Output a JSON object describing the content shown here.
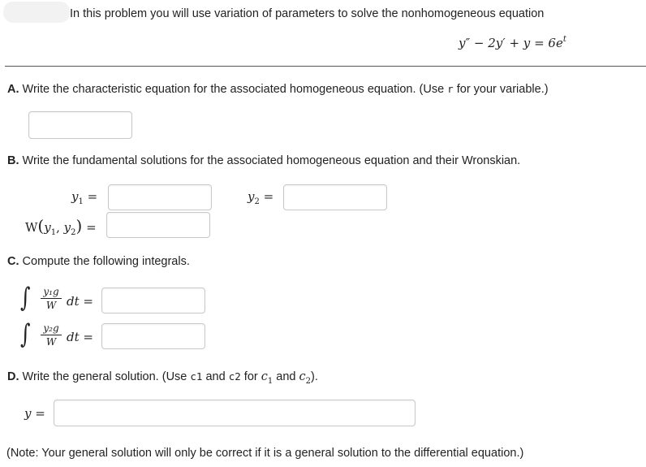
{
  "intro": "In this problem you will use variation of parameters to solve the nonhomogeneous equation",
  "equation": {
    "y_double_prime": "y″",
    "minus": "−",
    "two_y_prime": "2y′",
    "plus": "+",
    "y": "y",
    "equals": "=",
    "rhs_coef": "6e",
    "rhs_exp": "t"
  },
  "partA": {
    "letter": "A.",
    "text": " Write the characteristic equation for the associated homogeneous equation. (Use ",
    "var": "r",
    "text_end": " for your variable.)"
  },
  "partB": {
    "letter": "B.",
    "text": " Write the fundamental solutions for the associated homogeneous equation and their Wronskian.",
    "y1_label": "y",
    "y1_sub": "1",
    "y2_label": "y",
    "y2_sub": "2",
    "equals": "=",
    "wronskian_W": "W",
    "wronskian_open": "(",
    "wronskian_y1": "y",
    "wronskian_y1_sub": "1",
    "wronskian_comma": ", ",
    "wronskian_y2": "y",
    "wronskian_y2_sub": "2",
    "wronskian_close": ")"
  },
  "partC": {
    "letter": "C.",
    "text": " Compute the following integrals.",
    "integral_symbol": "∫",
    "int1_num": "y₁g",
    "int1_den": "W",
    "int2_num": "y₂g",
    "int2_den": "W",
    "dt": "dt",
    "equals": "="
  },
  "partD": {
    "letter": "D.",
    "text_pre": " Write the general solution. (Use ",
    "c1_code": "c1",
    "and1": " and ",
    "c2_code": "c2",
    "text_mid": " for ",
    "c1_math": "c",
    "c1_sub": "1",
    "and2": " and ",
    "c2_math": "c",
    "c2_sub": "2",
    "text_end": ").",
    "y_label": "y",
    "equals": "="
  },
  "note": "(Note: Your general solution will only be correct if it is a general solution to the differential equation.)"
}
